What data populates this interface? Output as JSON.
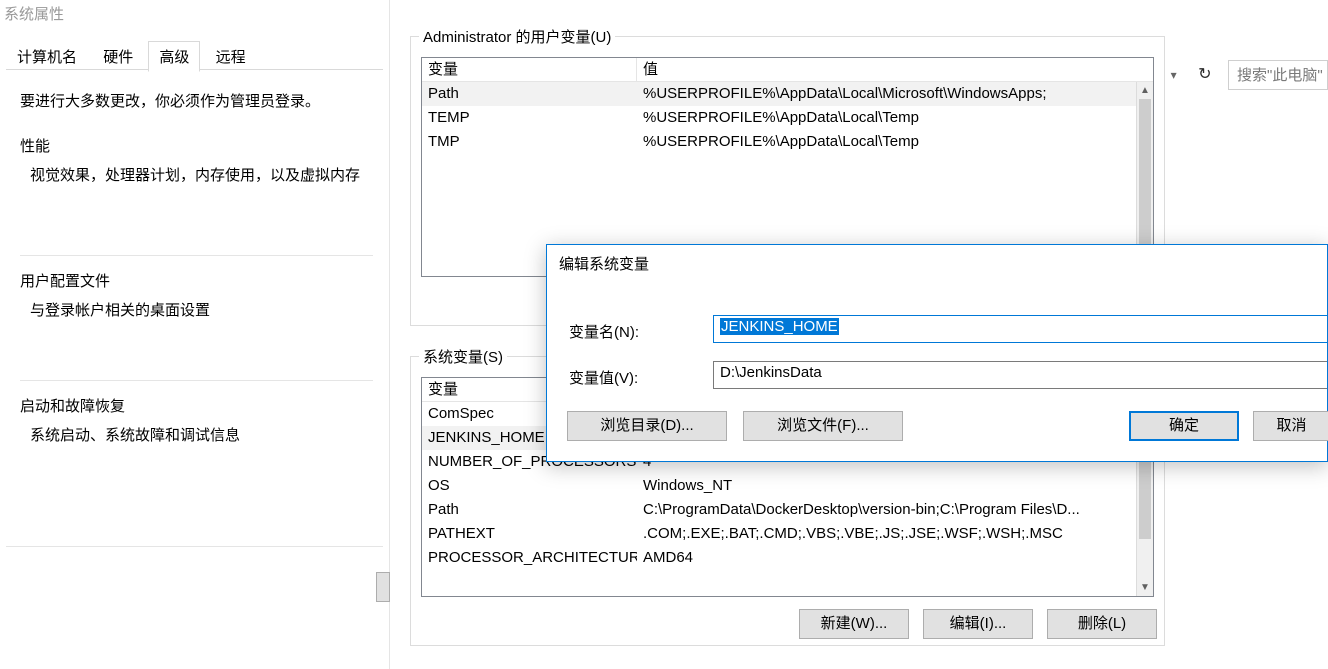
{
  "sysprops": {
    "title": "系统属性",
    "tabs": [
      "计算机名",
      "硬件",
      "高级",
      "远程"
    ],
    "active_tab_index": 2,
    "note": "要进行大多数更改，你必须作为管理员登录。",
    "groups": {
      "perf": {
        "title": "性能",
        "desc": "视觉效果，处理器计划，内存使用，以及虚拟内存"
      },
      "profile": {
        "title": "用户配置文件",
        "desc": "与登录帐户相关的桌面设置"
      },
      "startup": {
        "title": "启动和故障恢复",
        "desc": "系统启动、系统故障和调试信息"
      }
    }
  },
  "envvars": {
    "user_group_title": "Administrator 的用户变量(U)",
    "sys_group_title": "系统变量(S)",
    "columns": {
      "var": "变量",
      "val": "值"
    },
    "user_vars": [
      {
        "name": "Path",
        "value": "%USERPROFILE%\\AppData\\Local\\Microsoft\\WindowsApps;",
        "selected": true
      },
      {
        "name": "TEMP",
        "value": "%USERPROFILE%\\AppData\\Local\\Temp"
      },
      {
        "name": "TMP",
        "value": "%USERPROFILE%\\AppData\\Local\\Temp"
      }
    ],
    "sys_vars": [
      {
        "name": "ComSpec",
        "value": ""
      },
      {
        "name": "JENKINS_HOME",
        "value": "",
        "selected": true
      },
      {
        "name": "NUMBER_OF_PROCESSORS",
        "value": "4"
      },
      {
        "name": "OS",
        "value": "Windows_NT"
      },
      {
        "name": "Path",
        "value": "C:\\ProgramData\\DockerDesktop\\version-bin;C:\\Program Files\\D..."
      },
      {
        "name": "PATHEXT",
        "value": ".COM;.EXE;.BAT;.CMD;.VBS;.VBE;.JS;.JSE;.WSF;.WSH;.MSC"
      },
      {
        "name": "PROCESSOR_ARCHITECTURE",
        "value": "AMD64"
      }
    ],
    "buttons": {
      "new": "新建(W)...",
      "edit": "编辑(I)...",
      "delete": "删除(L)"
    }
  },
  "editdlg": {
    "title": "编辑系统变量",
    "name_label": "变量名(N):",
    "value_label": "变量值(V):",
    "name_value": "JENKINS_HOME",
    "value_value": "D:\\JenkinsData",
    "browse_dir": "浏览目录(D)...",
    "browse_file": "浏览文件(F)...",
    "ok": "确定",
    "cancel": "取消"
  },
  "explorer": {
    "search_placeholder": "搜索\"此电脑\""
  }
}
